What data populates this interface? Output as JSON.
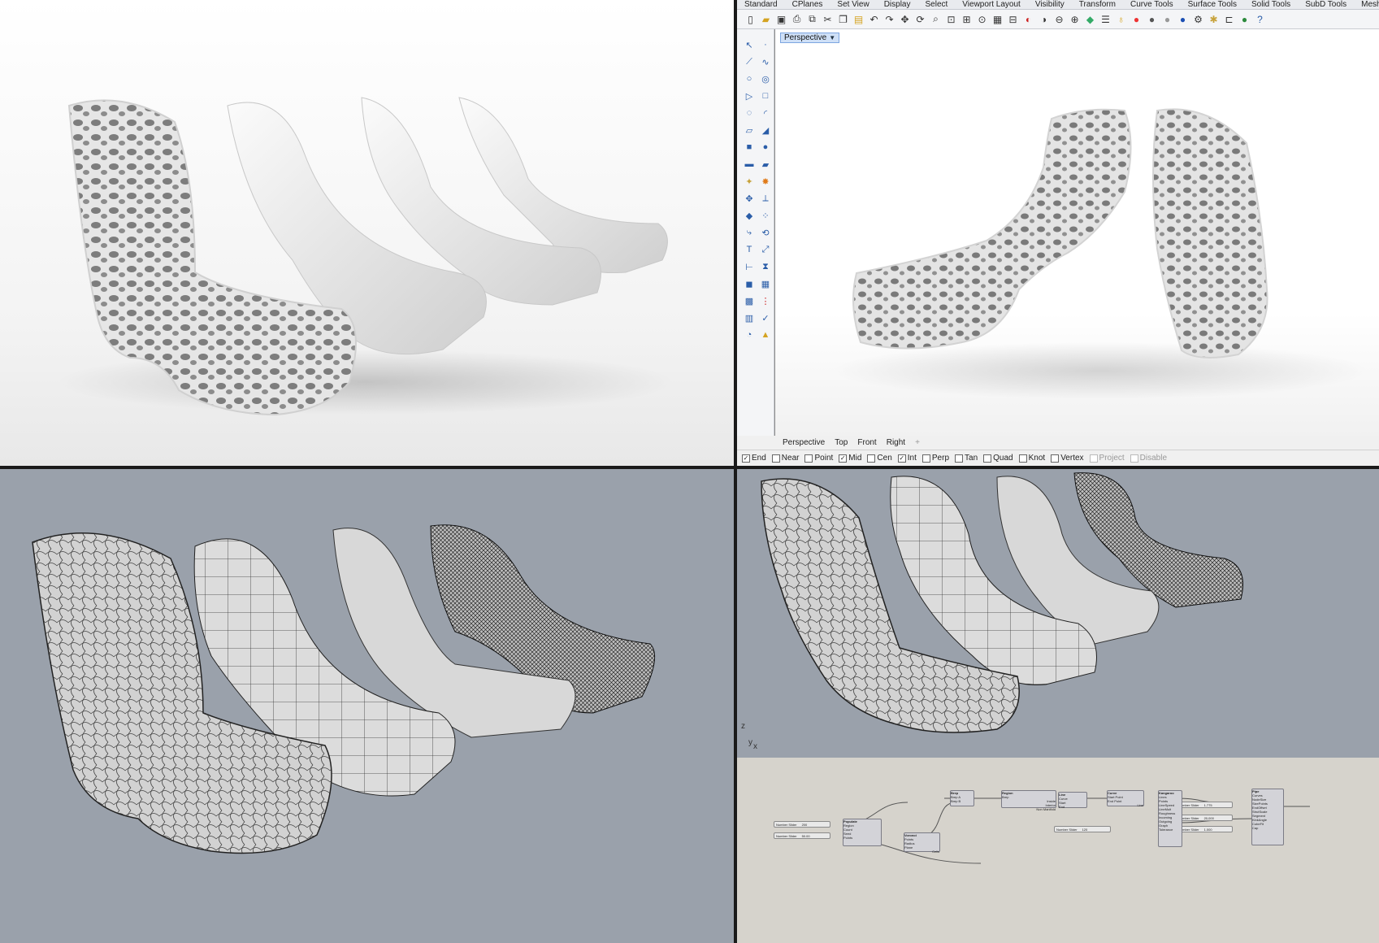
{
  "rhino": {
    "menu_tabs": [
      "Standard",
      "CPlanes",
      "Set View",
      "Display",
      "Select",
      "Viewport Layout",
      "Visibility",
      "Transform",
      "Curve Tools",
      "Surface Tools",
      "Solid Tools",
      "SubD Tools",
      "Mesh Tools"
    ],
    "toolbar_icons": [
      "new-icon",
      "open-icon",
      "save-icon",
      "print-icon",
      "import-icon",
      "cut-icon",
      "copy-icon",
      "paste-icon",
      "undo-icon",
      "redo-icon",
      "pan-icon",
      "rotate-icon",
      "zoom-icon",
      "zoom-window-icon",
      "zoom-extents-icon",
      "zoom-selected-icon",
      "viewport-layout-icon",
      "four-view-icon",
      "hide-icon",
      "show-icon",
      "lock-icon",
      "unlock-icon",
      "layer-icon",
      "properties-icon",
      "bulb-icon",
      "color-wheel-icon",
      "shaded-sphere-icon",
      "rendered-sphere-icon",
      "material-sphere-icon",
      "options-icon",
      "gear-icon",
      "spacer-icon",
      "grasshopper-icon",
      "help-icon"
    ],
    "viewport_label": "Perspective",
    "view_tabs": [
      "Perspective",
      "Top",
      "Front",
      "Right"
    ],
    "view_tab_add": "+",
    "osnaps": [
      {
        "label": "End",
        "checked": true,
        "disabled": false
      },
      {
        "label": "Near",
        "checked": false,
        "disabled": false
      },
      {
        "label": "Point",
        "checked": false,
        "disabled": false
      },
      {
        "label": "Mid",
        "checked": true,
        "disabled": false
      },
      {
        "label": "Cen",
        "checked": false,
        "disabled": false
      },
      {
        "label": "Int",
        "checked": true,
        "disabled": false
      },
      {
        "label": "Perp",
        "checked": false,
        "disabled": false
      },
      {
        "label": "Tan",
        "checked": false,
        "disabled": false
      },
      {
        "label": "Quad",
        "checked": false,
        "disabled": false
      },
      {
        "label": "Knot",
        "checked": false,
        "disabled": false
      },
      {
        "label": "Vertex",
        "checked": false,
        "disabled": false
      },
      {
        "label": "Project",
        "checked": false,
        "disabled": true
      },
      {
        "label": "Disable",
        "checked": false,
        "disabled": true
      }
    ]
  },
  "axes": {
    "z": "z",
    "y": "y",
    "x": "x"
  },
  "grasshopper": {
    "sliders": [
      {
        "label": "Number Slider",
        "value": "200"
      },
      {
        "label": "Number Slider",
        "value": "50.00"
      },
      {
        "label": "Number Slider",
        "value": "1.775"
      },
      {
        "label": "Number Slider",
        "value": "20,000"
      },
      {
        "label": "Number Slider",
        "value": "1.000"
      },
      {
        "label": "Number Slider",
        "value": "120"
      }
    ],
    "nodes": [
      {
        "name": "Populate",
        "inputs": [
          "Region",
          "Count",
          "Seed",
          "Points"
        ]
      },
      {
        "name": "Voronoi",
        "inputs": [
          "Points",
          "Radius",
          "Plane"
        ],
        "outputs": [
          "Cells"
        ]
      },
      {
        "name": "Brep",
        "inputs": [
          "Brep A",
          "Brep B"
        ]
      },
      {
        "name": "Region",
        "inputs": [
          "Brep"
        ],
        "outputs": [
          "Inside",
          "Interior",
          "Non Manifold"
        ]
      },
      {
        "name": "Line",
        "inputs": [
          "Curve",
          "Start",
          "End"
        ]
      },
      {
        "name": "Curve",
        "inputs": [
          "Start Point",
          "End Point"
        ],
        "outputs": [
          "Line"
        ]
      },
      {
        "name": "Kangaroo",
        "inputs": [
          "Lines",
          "Points",
          "LineSpeed",
          "LineMult",
          "Roughness",
          "Incoming",
          "Outgoing",
          "Graph",
          "Tolerance"
        ]
      },
      {
        "name": "Pipe",
        "inputs": [
          "Curves",
          "NodeSize",
          "SizePoints",
          "EndOffset",
          "StrutScale",
          "Segment",
          "KinkAngle",
          "CubeFit",
          "Cap"
        ]
      }
    ]
  }
}
